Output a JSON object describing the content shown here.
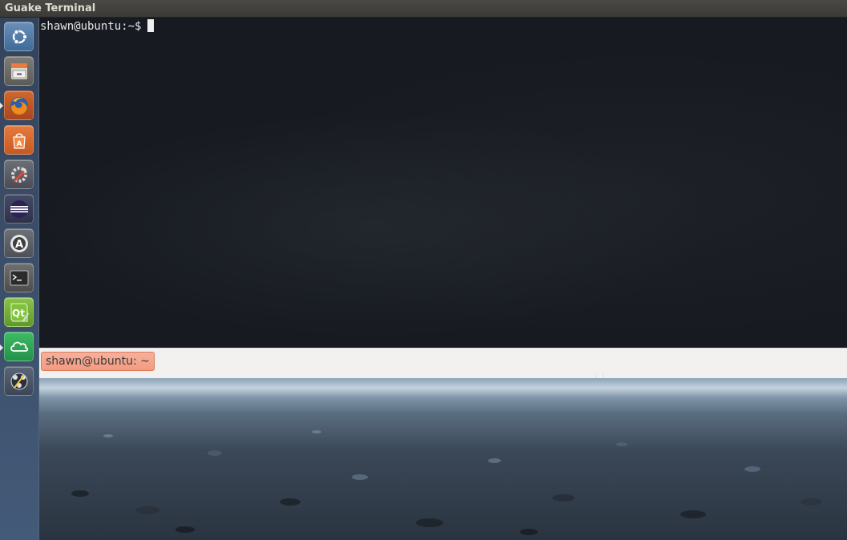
{
  "window": {
    "title": "Guake Terminal"
  },
  "terminal": {
    "prompt": "shawn@ubuntu:~$"
  },
  "tabs": [
    {
      "label": "shawn@ubuntu: ~"
    }
  ],
  "launcher": {
    "items": [
      {
        "name": "Dash Home",
        "icon": "ubuntu-logo-icon",
        "running": false
      },
      {
        "name": "Files",
        "icon": "file-cabinet-icon",
        "running": false
      },
      {
        "name": "Firefox",
        "icon": "firefox-icon",
        "running": true
      },
      {
        "name": "Ubuntu Software Center",
        "icon": "software-center-icon",
        "running": false
      },
      {
        "name": "System Settings",
        "icon": "settings-wrench-icon",
        "running": false
      },
      {
        "name": "Eclipse",
        "icon": "eclipse-icon",
        "running": false
      },
      {
        "name": "Software Updater",
        "icon": "software-updater-icon",
        "running": false
      },
      {
        "name": "Terminal",
        "icon": "terminal-icon",
        "running": false
      },
      {
        "name": "Qt Creator",
        "icon": "qt-creator-icon",
        "running": false
      },
      {
        "name": "Cloud Sync",
        "icon": "cloud-icon",
        "running": true
      },
      {
        "name": "Unity Tweak Tool",
        "icon": "tweak-tool-icon",
        "running": false
      }
    ]
  },
  "colors": {
    "tab_active": "#f39b80",
    "terminal_bg": "#171b21",
    "launcher_bg": "#3a4d68"
  }
}
